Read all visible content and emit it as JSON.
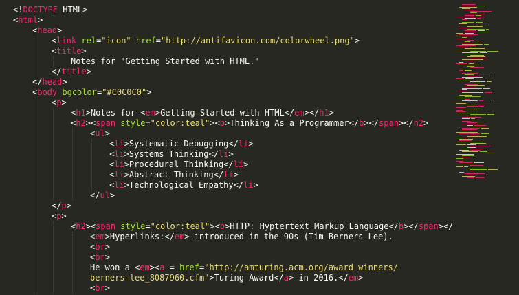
{
  "colors": {
    "background": "#272822",
    "tag": "#f92672",
    "attribute": "#a6e22e",
    "string": "#e6db74",
    "text": "#f8f8f2",
    "guide": "#4a4a42"
  },
  "lines": [
    {
      "indent": 0,
      "tokens": [
        {
          "t": "<!",
          "c": "text"
        },
        {
          "t": "DOCTYPE",
          "c": "tag"
        },
        {
          "t": " HTML>",
          "c": "text"
        }
      ]
    },
    {
      "indent": 0,
      "tokens": [
        {
          "t": "<",
          "c": "text"
        },
        {
          "t": "html",
          "c": "tag"
        },
        {
          "t": ">",
          "c": "text"
        }
      ]
    },
    {
      "indent": 1,
      "tokens": [
        {
          "t": "<",
          "c": "text"
        },
        {
          "t": "head",
          "c": "tag"
        },
        {
          "t": ">",
          "c": "text"
        }
      ]
    },
    {
      "indent": 2,
      "tokens": [
        {
          "t": "<",
          "c": "text"
        },
        {
          "t": "link",
          "c": "tag"
        },
        {
          "t": " ",
          "c": "text"
        },
        {
          "t": "rel",
          "c": "attribute"
        },
        {
          "t": "=",
          "c": "text"
        },
        {
          "t": "\"icon\"",
          "c": "string"
        },
        {
          "t": " ",
          "c": "text"
        },
        {
          "t": "href",
          "c": "attribute"
        },
        {
          "t": "=",
          "c": "text"
        },
        {
          "t": "\"http://antifavicon.com/colorwheel.png\"",
          "c": "string"
        },
        {
          "t": ">",
          "c": "text"
        }
      ]
    },
    {
      "indent": 2,
      "tokens": [
        {
          "t": "<",
          "c": "text"
        },
        {
          "t": "title",
          "c": "tag"
        },
        {
          "t": ">",
          "c": "text"
        }
      ]
    },
    {
      "indent": 3,
      "tokens": [
        {
          "t": "Notes for \"Getting Started with HTML.\"",
          "c": "text"
        }
      ]
    },
    {
      "indent": 2,
      "tokens": [
        {
          "t": "</",
          "c": "text"
        },
        {
          "t": "title",
          "c": "tag"
        },
        {
          "t": ">",
          "c": "text"
        }
      ]
    },
    {
      "indent": 1,
      "tokens": [
        {
          "t": "</",
          "c": "text"
        },
        {
          "t": "head",
          "c": "tag"
        },
        {
          "t": ">",
          "c": "text"
        }
      ]
    },
    {
      "indent": 1,
      "tokens": [
        {
          "t": "<",
          "c": "text"
        },
        {
          "t": "body",
          "c": "tag"
        },
        {
          "t": " ",
          "c": "text"
        },
        {
          "t": "bgcolor",
          "c": "attribute"
        },
        {
          "t": "=",
          "c": "text"
        },
        {
          "t": "\"#C0C0C0\"",
          "c": "string"
        },
        {
          "t": ">",
          "c": "text"
        }
      ]
    },
    {
      "indent": 2,
      "tokens": [
        {
          "t": "<",
          "c": "text"
        },
        {
          "t": "p",
          "c": "tag"
        },
        {
          "t": ">",
          "c": "text"
        }
      ]
    },
    {
      "indent": 3,
      "tokens": [
        {
          "t": "<",
          "c": "text"
        },
        {
          "t": "h1",
          "c": "tag"
        },
        {
          "t": ">Notes for <",
          "c": "text"
        },
        {
          "t": "em",
          "c": "tag"
        },
        {
          "t": ">Getting Started with HTML</",
          "c": "text"
        },
        {
          "t": "em",
          "c": "tag"
        },
        {
          "t": "></",
          "c": "text"
        },
        {
          "t": "h1",
          "c": "tag"
        },
        {
          "t": ">",
          "c": "text"
        }
      ]
    },
    {
      "indent": 3,
      "tokens": [
        {
          "t": "<",
          "c": "text"
        },
        {
          "t": "h2",
          "c": "tag"
        },
        {
          "t": "><",
          "c": "text"
        },
        {
          "t": "span",
          "c": "tag"
        },
        {
          "t": " ",
          "c": "text"
        },
        {
          "t": "style",
          "c": "attribute"
        },
        {
          "t": "=",
          "c": "text"
        },
        {
          "t": "\"color:teal\"",
          "c": "string"
        },
        {
          "t": "><",
          "c": "text"
        },
        {
          "t": "b",
          "c": "tag"
        },
        {
          "t": ">Thinking As a Programmer</",
          "c": "text"
        },
        {
          "t": "b",
          "c": "tag"
        },
        {
          "t": "></",
          "c": "text"
        },
        {
          "t": "span",
          "c": "tag"
        },
        {
          "t": "></",
          "c": "text"
        },
        {
          "t": "h2",
          "c": "tag"
        },
        {
          "t": ">",
          "c": "text"
        }
      ]
    },
    {
      "indent": 4,
      "tokens": [
        {
          "t": "<",
          "c": "text"
        },
        {
          "t": "ul",
          "c": "tag"
        },
        {
          "t": ">",
          "c": "text"
        }
      ]
    },
    {
      "indent": 5,
      "tokens": [
        {
          "t": "<",
          "c": "text"
        },
        {
          "t": "li",
          "c": "tag"
        },
        {
          "t": ">Systematic Debugging</",
          "c": "text"
        },
        {
          "t": "li",
          "c": "tag"
        },
        {
          "t": ">",
          "c": "text"
        }
      ]
    },
    {
      "indent": 5,
      "tokens": [
        {
          "t": "<",
          "c": "text"
        },
        {
          "t": "li",
          "c": "tag"
        },
        {
          "t": ">Systems Thinking</",
          "c": "text"
        },
        {
          "t": "li",
          "c": "tag"
        },
        {
          "t": ">",
          "c": "text"
        }
      ]
    },
    {
      "indent": 5,
      "tokens": [
        {
          "t": "<",
          "c": "text"
        },
        {
          "t": "li",
          "c": "tag"
        },
        {
          "t": ">Procedural Thinking</",
          "c": "text"
        },
        {
          "t": "li",
          "c": "tag"
        },
        {
          "t": ">",
          "c": "text"
        }
      ]
    },
    {
      "indent": 5,
      "tokens": [
        {
          "t": "<",
          "c": "text"
        },
        {
          "t": "li",
          "c": "tag"
        },
        {
          "t": ">Abstract Thinking</",
          "c": "text"
        },
        {
          "t": "li",
          "c": "tag"
        },
        {
          "t": ">",
          "c": "text"
        }
      ]
    },
    {
      "indent": 5,
      "tokens": [
        {
          "t": "<",
          "c": "text"
        },
        {
          "t": "li",
          "c": "tag"
        },
        {
          "t": ">Technological Empathy</",
          "c": "text"
        },
        {
          "t": "li",
          "c": "tag"
        },
        {
          "t": ">",
          "c": "text"
        }
      ]
    },
    {
      "indent": 4,
      "tokens": [
        {
          "t": "</",
          "c": "text"
        },
        {
          "t": "ul",
          "c": "tag"
        },
        {
          "t": ">",
          "c": "text"
        }
      ]
    },
    {
      "indent": 2,
      "tokens": [
        {
          "t": "</",
          "c": "text"
        },
        {
          "t": "p",
          "c": "tag"
        },
        {
          "t": ">",
          "c": "text"
        }
      ]
    },
    {
      "indent": 2,
      "tokens": [
        {
          "t": "<",
          "c": "text"
        },
        {
          "t": "p",
          "c": "tag"
        },
        {
          "t": ">",
          "c": "text"
        }
      ]
    },
    {
      "indent": 3,
      "tokens": [
        {
          "t": "<",
          "c": "text"
        },
        {
          "t": "h2",
          "c": "tag"
        },
        {
          "t": "><",
          "c": "text"
        },
        {
          "t": "span",
          "c": "tag"
        },
        {
          "t": " ",
          "c": "text"
        },
        {
          "t": "style",
          "c": "attribute"
        },
        {
          "t": "=",
          "c": "text"
        },
        {
          "t": "\"color:teal\"",
          "c": "string"
        },
        {
          "t": "><",
          "c": "text"
        },
        {
          "t": "b",
          "c": "tag"
        },
        {
          "t": ">HTTP: Hyptertext Markup Language</",
          "c": "text"
        },
        {
          "t": "b",
          "c": "tag"
        },
        {
          "t": "></",
          "c": "text"
        },
        {
          "t": "span",
          "c": "tag"
        },
        {
          "t": "></",
          "c": "text"
        },
        {
          "t": "h2",
          "c": "tag"
        },
        {
          "t": ">",
          "c": "text"
        }
      ]
    },
    {
      "indent": 4,
      "tokens": [
        {
          "t": "<",
          "c": "text"
        },
        {
          "t": "em",
          "c": "tag"
        },
        {
          "t": ">Hyperlinks:</",
          "c": "text"
        },
        {
          "t": "em",
          "c": "tag"
        },
        {
          "t": "> introduced in the 90s (Tim Berners-Lee).",
          "c": "text"
        }
      ]
    },
    {
      "indent": 4,
      "tokens": [
        {
          "t": "<",
          "c": "text"
        },
        {
          "t": "br",
          "c": "tag"
        },
        {
          "t": ">",
          "c": "text"
        }
      ]
    },
    {
      "indent": 4,
      "tokens": [
        {
          "t": "<",
          "c": "text"
        },
        {
          "t": "br",
          "c": "tag"
        },
        {
          "t": ">",
          "c": "text"
        }
      ]
    },
    {
      "indent": 4,
      "tokens": [
        {
          "t": "He won a <",
          "c": "text"
        },
        {
          "t": "em",
          "c": "tag"
        },
        {
          "t": "><",
          "c": "text"
        },
        {
          "t": "a",
          "c": "tag"
        },
        {
          "t": " = ",
          "c": "text"
        },
        {
          "t": "href",
          "c": "attribute"
        },
        {
          "t": "=",
          "c": "text"
        },
        {
          "t": "\"http://amturing.acm.org/award_winners/",
          "c": "string"
        }
      ]
    },
    {
      "indent": 4,
      "tokens": [
        {
          "t": "berners-lee_8087960.cfm\"",
          "c": "string"
        },
        {
          "t": ">Turing Award</",
          "c": "text"
        },
        {
          "t": "a",
          "c": "tag"
        },
        {
          "t": "> in 2016.</",
          "c": "text"
        },
        {
          "t": "em",
          "c": "tag"
        },
        {
          "t": ">",
          "c": "text"
        }
      ]
    },
    {
      "indent": 4,
      "tokens": [
        {
          "t": "<",
          "c": "text"
        },
        {
          "t": "br",
          "c": "tag"
        },
        {
          "t": ">",
          "c": "text"
        }
      ]
    }
  ]
}
